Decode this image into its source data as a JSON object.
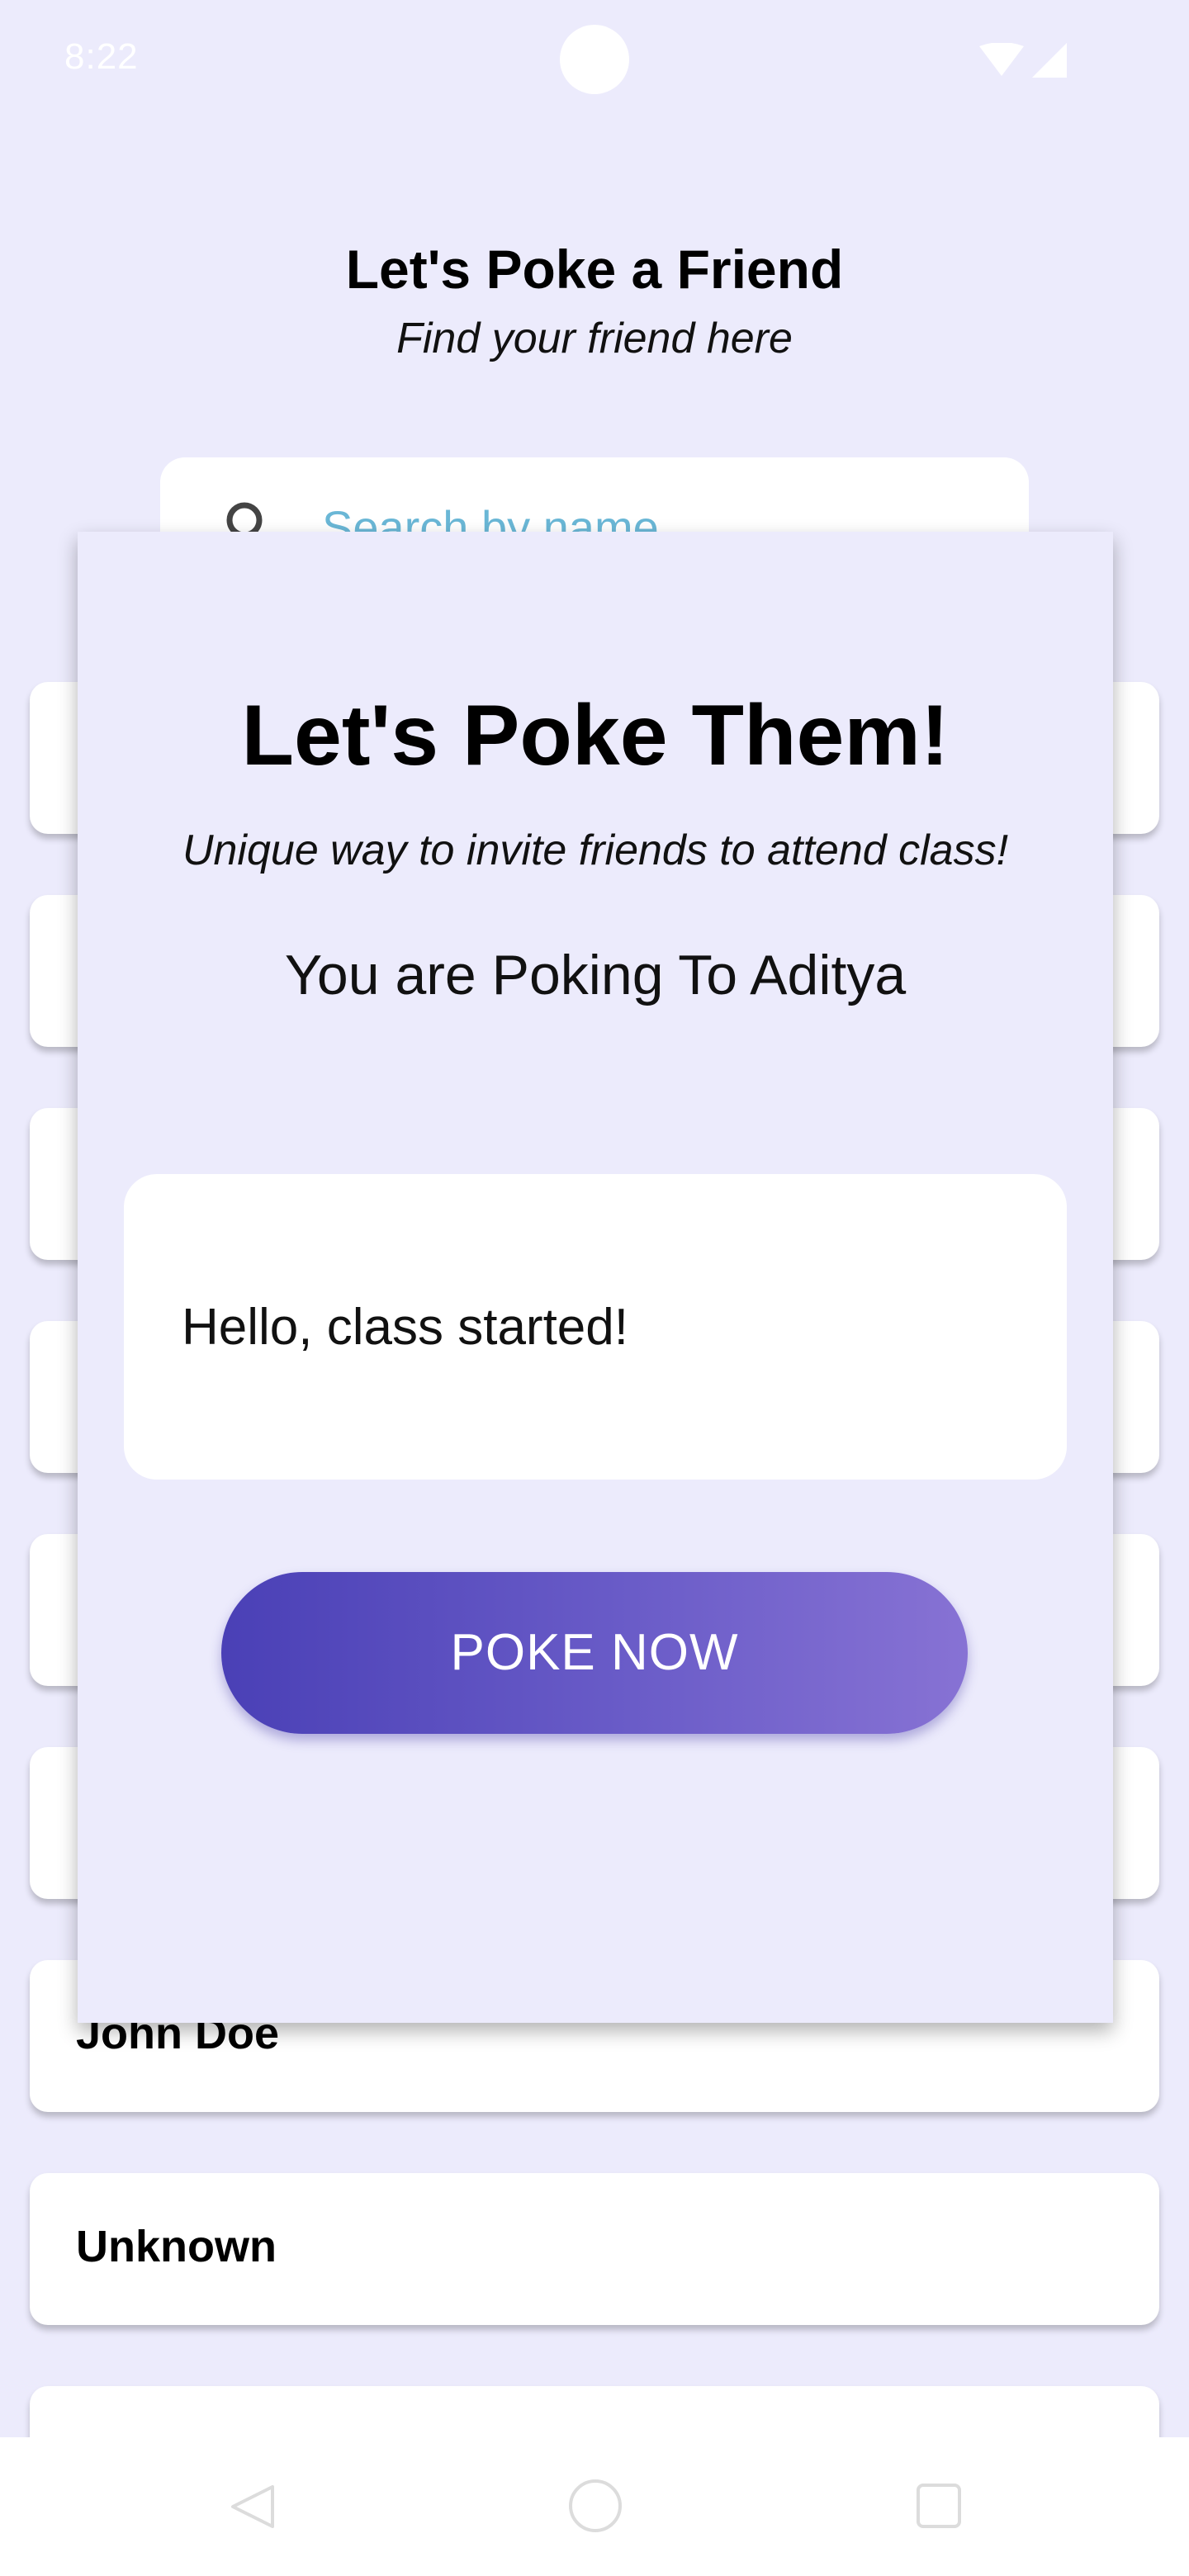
{
  "status_bar": {
    "time": "8:22",
    "icons": [
      "wifi-icon",
      "signal-icon"
    ]
  },
  "header": {
    "title": "Let's Poke a Friend",
    "subtitle": "Find your friend here"
  },
  "search": {
    "placeholder": "Search by name",
    "icon": "search-icon"
  },
  "friend_list": [
    {
      "name": ""
    },
    {
      "name": ""
    },
    {
      "name": ""
    },
    {
      "name": ""
    },
    {
      "name": ""
    },
    {
      "name": ""
    },
    {
      "name": "John Doe"
    },
    {
      "name": "Unknown"
    },
    {
      "name": ""
    }
  ],
  "modal": {
    "title": "Let's Poke Them!",
    "subtitle": "Unique way to invite friends to attend class!",
    "target_text": "You are Poking To Aditya",
    "message": "Hello, class started!",
    "button_label": "POKE NOW"
  },
  "nav_bar": {
    "icons": [
      "back-icon",
      "home-icon",
      "recents-icon"
    ]
  },
  "colors": {
    "background": "#ecebfc",
    "search_placeholder": "#6ab7d6",
    "button_gradient_start": "#4a40b6",
    "button_gradient_end": "#8772d4"
  }
}
